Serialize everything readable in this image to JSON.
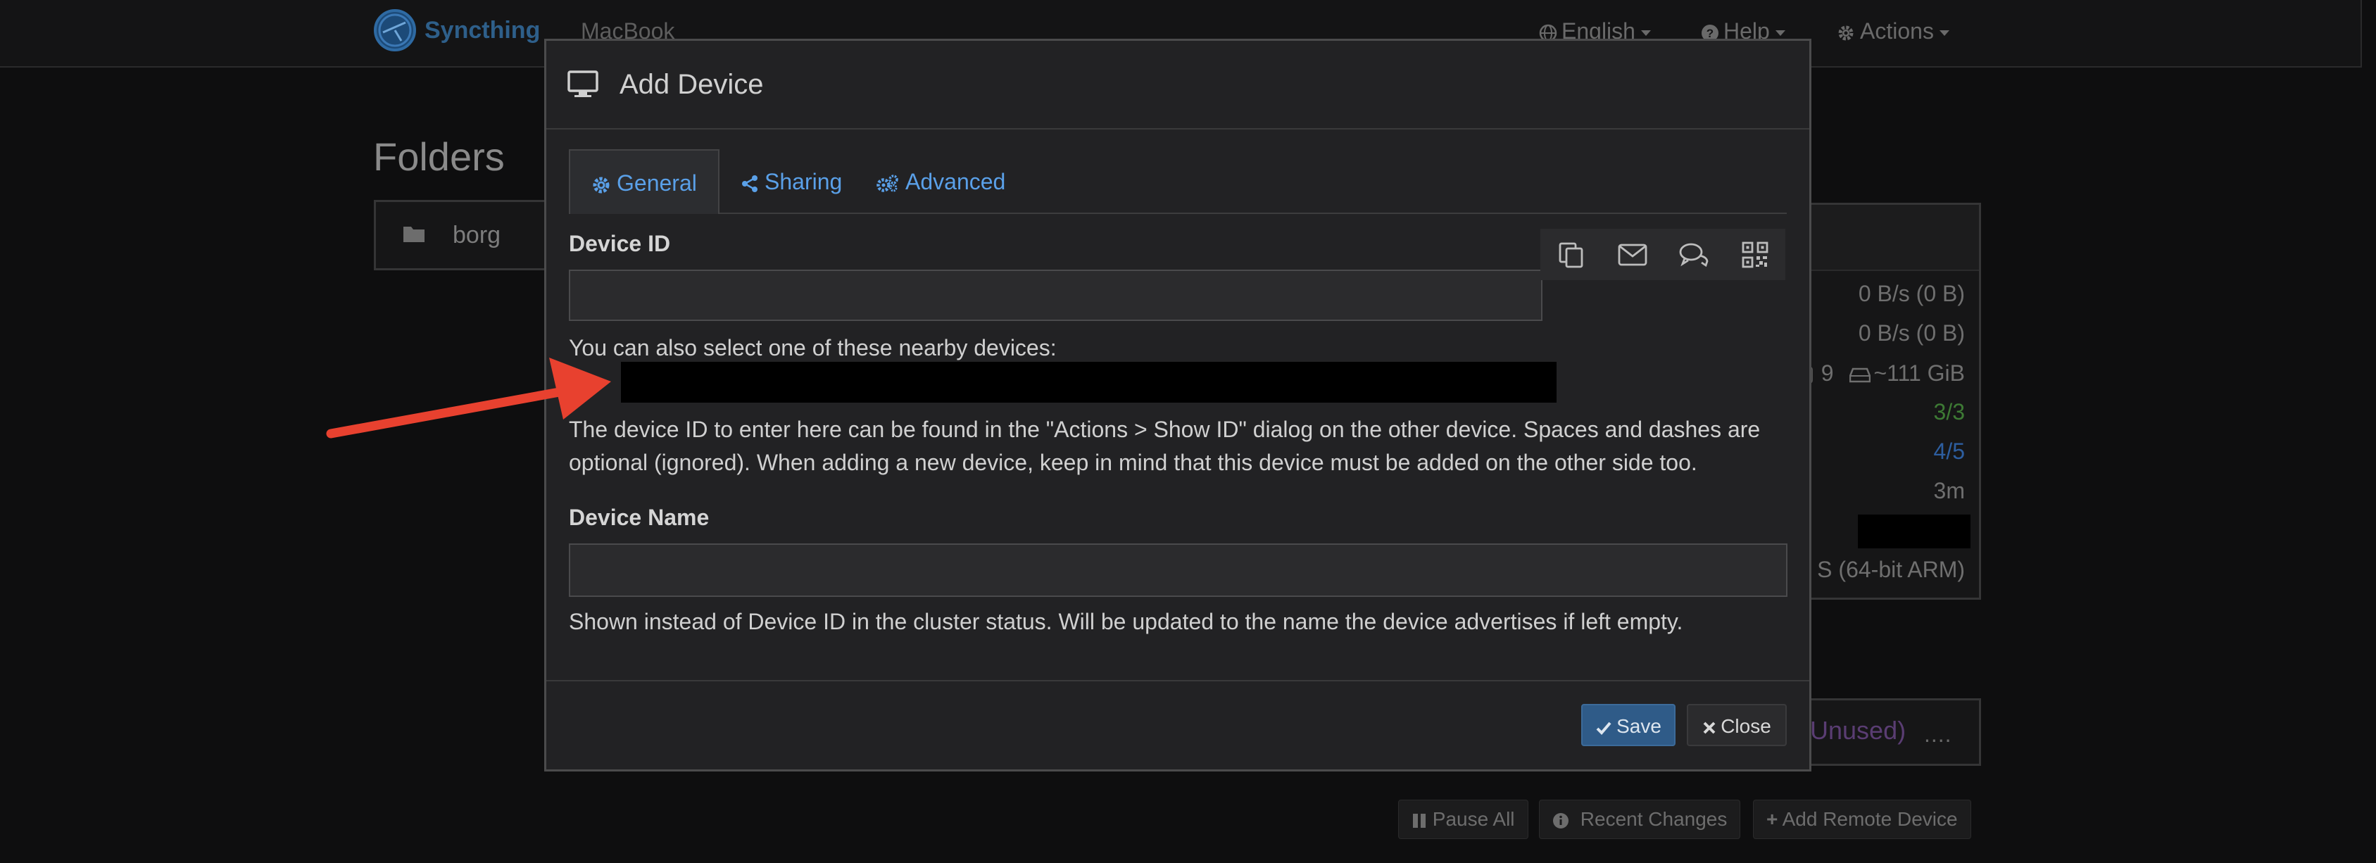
{
  "navbar": {
    "brand": "Syncthing",
    "device_name": "MacBook",
    "language": "English",
    "help": "Help",
    "actions": "Actions"
  },
  "folders": {
    "title": "Folders",
    "items": [
      {
        "name": "borg"
      }
    ]
  },
  "this_device": {
    "rows": [
      "0 B/s (0 B)",
      "0 B/s (0 B)",
      "9",
      "~111 GiB",
      "3/3",
      "4/5",
      "3m",
      "S (64-bit ARM)"
    ],
    "colors": {
      "green": "#3d7a34",
      "blue": "#2d5ea0"
    }
  },
  "remote": {
    "unused_label": "Unused)",
    "dots": "...."
  },
  "bottom_actions": {
    "pause_all": "Pause All",
    "recent_changes": "Recent Changes",
    "add_remote_device": "Add Remote Device"
  },
  "modal": {
    "title": "Add Device",
    "tabs": [
      {
        "label": "General",
        "icon": "gear-icon",
        "active": true
      },
      {
        "label": "Sharing",
        "icon": "share-icon",
        "active": false
      },
      {
        "label": "Advanced",
        "icon": "gears-icon",
        "active": false
      }
    ],
    "device_id": {
      "label": "Device ID",
      "value": "",
      "nearby_text": "You can also select one of these nearby devices:",
      "help_line1": "The device ID to enter here can be found in the \"Actions > Show ID\" dialog on the other device. Spaces and dashes are",
      "help_line2": "optional (ignored). When adding a new device, keep in mind that this device must be added on the other side too."
    },
    "device_name": {
      "label": "Device Name",
      "value": "",
      "help": "Shown instead of Device ID in the cluster status. Will be updated to the name the device advertises if left empty."
    },
    "footer": {
      "save": "Save",
      "close": "Close"
    }
  },
  "annotation": {
    "arrow_color": "#e8412f"
  }
}
